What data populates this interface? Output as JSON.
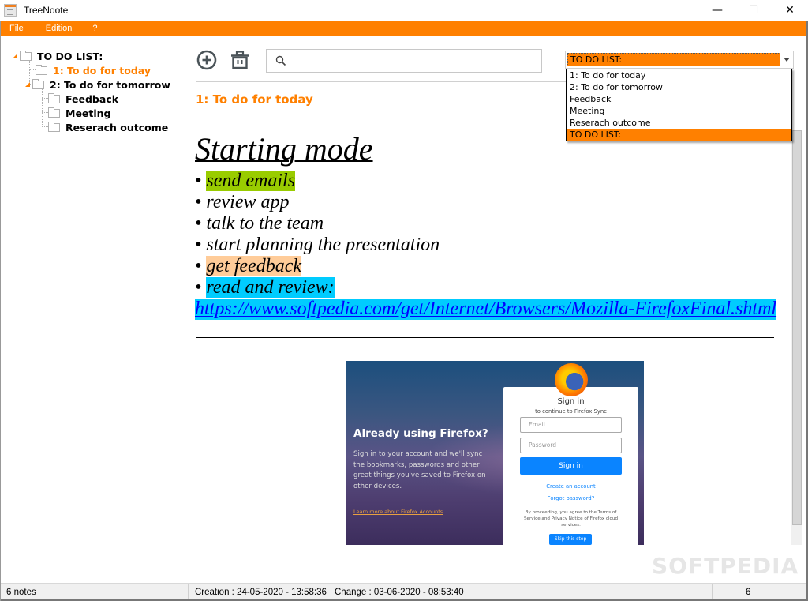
{
  "window": {
    "title": "TreeNoote",
    "controls": {
      "minimize": "—",
      "maximize": "☐",
      "close": "✕"
    }
  },
  "menu": [
    "File",
    "Edition",
    "?"
  ],
  "tree": {
    "root": {
      "label": "TO DO LIST:",
      "expanded": true
    },
    "items": [
      {
        "label": "1: To do for today",
        "level": 1,
        "active": true
      },
      {
        "label": "2: To do for tomorrow",
        "level": 1,
        "expanded": true
      },
      {
        "label": "Feedback",
        "level": 2
      },
      {
        "label": "Meeting",
        "level": 2
      },
      {
        "label": "Reserach outcome",
        "level": 2
      }
    ]
  },
  "toolbar": {
    "add_icon": "add-circle-icon",
    "delete_icon": "trash-icon",
    "search": {
      "value": "",
      "placeholder": "",
      "icon": "search-icon"
    }
  },
  "combo": {
    "selected": "TO DO LIST:",
    "options": [
      "1: To do for today",
      "2: To do for tomorrow",
      "Feedback",
      "Meeting",
      "Reserach outcome",
      "TO DO LIST:"
    ]
  },
  "note": {
    "title": "1: To do for today",
    "heading": "Starting mode",
    "bullets": [
      {
        "text": "send emails",
        "highlight": "#99cc00"
      },
      {
        "text": "review app",
        "highlight": ""
      },
      {
        "text": "talk to the team",
        "highlight": ""
      },
      {
        "text": "start planning the presentation",
        "highlight": ""
      },
      {
        "text": "get feedback",
        "highlight": "#ffcc99"
      },
      {
        "text": "read and review: ",
        "highlight": "#00ccff"
      }
    ],
    "bullet_char": "•",
    "link": "https://www.softpedia.com/get/Internet/Browsers/Mozilla-FirefoxFinal.shtml",
    "embedded_image": {
      "heading": "Already using Firefox?",
      "body": "Sign in to your account and we'll sync the bookmarks, passwords and other great things you've saved to Firefox on other devices.",
      "learn_more": "Learn more about Firefox Accounts",
      "panel": {
        "title": "Sign in",
        "subtitle": "to continue to Firefox Sync",
        "email_placeholder": "Email",
        "password_placeholder": "Password",
        "sign_in": "Sign in",
        "create_account": "Create an account",
        "forgot_password": "Forgot password?",
        "legal": "By proceeding, you agree to the Terms of Service and Privacy Notice of Firefox cloud services.",
        "skip": "Skip this step"
      }
    }
  },
  "status": {
    "notes": "6 notes",
    "creation": "Creation : 24-05-2020 - 13:58:36",
    "change": "Change : 03-06-2020 - 08:53:40",
    "count": "6"
  },
  "watermark": "SOFTPEDIA",
  "colors": {
    "accent": "#ff8000",
    "link": "#0000ff"
  }
}
